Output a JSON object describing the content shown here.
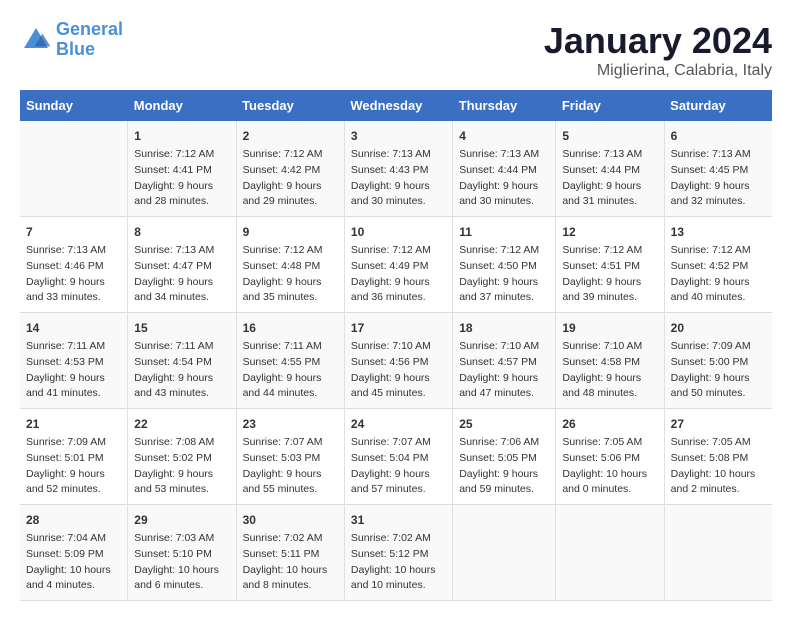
{
  "header": {
    "logo_line1": "General",
    "logo_line2": "Blue",
    "title": "January 2024",
    "subtitle": "Miglierina, Calabria, Italy"
  },
  "days_of_week": [
    "Sunday",
    "Monday",
    "Tuesday",
    "Wednesday",
    "Thursday",
    "Friday",
    "Saturday"
  ],
  "weeks": [
    [
      {
        "day": "",
        "content": ""
      },
      {
        "day": "1",
        "content": "Sunrise: 7:12 AM\nSunset: 4:41 PM\nDaylight: 9 hours\nand 28 minutes."
      },
      {
        "day": "2",
        "content": "Sunrise: 7:12 AM\nSunset: 4:42 PM\nDaylight: 9 hours\nand 29 minutes."
      },
      {
        "day": "3",
        "content": "Sunrise: 7:13 AM\nSunset: 4:43 PM\nDaylight: 9 hours\nand 30 minutes."
      },
      {
        "day": "4",
        "content": "Sunrise: 7:13 AM\nSunset: 4:44 PM\nDaylight: 9 hours\nand 30 minutes."
      },
      {
        "day": "5",
        "content": "Sunrise: 7:13 AM\nSunset: 4:44 PM\nDaylight: 9 hours\nand 31 minutes."
      },
      {
        "day": "6",
        "content": "Sunrise: 7:13 AM\nSunset: 4:45 PM\nDaylight: 9 hours\nand 32 minutes."
      }
    ],
    [
      {
        "day": "7",
        "content": "Sunrise: 7:13 AM\nSunset: 4:46 PM\nDaylight: 9 hours\nand 33 minutes."
      },
      {
        "day": "8",
        "content": "Sunrise: 7:13 AM\nSunset: 4:47 PM\nDaylight: 9 hours\nand 34 minutes."
      },
      {
        "day": "9",
        "content": "Sunrise: 7:12 AM\nSunset: 4:48 PM\nDaylight: 9 hours\nand 35 minutes."
      },
      {
        "day": "10",
        "content": "Sunrise: 7:12 AM\nSunset: 4:49 PM\nDaylight: 9 hours\nand 36 minutes."
      },
      {
        "day": "11",
        "content": "Sunrise: 7:12 AM\nSunset: 4:50 PM\nDaylight: 9 hours\nand 37 minutes."
      },
      {
        "day": "12",
        "content": "Sunrise: 7:12 AM\nSunset: 4:51 PM\nDaylight: 9 hours\nand 39 minutes."
      },
      {
        "day": "13",
        "content": "Sunrise: 7:12 AM\nSunset: 4:52 PM\nDaylight: 9 hours\nand 40 minutes."
      }
    ],
    [
      {
        "day": "14",
        "content": "Sunrise: 7:11 AM\nSunset: 4:53 PM\nDaylight: 9 hours\nand 41 minutes."
      },
      {
        "day": "15",
        "content": "Sunrise: 7:11 AM\nSunset: 4:54 PM\nDaylight: 9 hours\nand 43 minutes."
      },
      {
        "day": "16",
        "content": "Sunrise: 7:11 AM\nSunset: 4:55 PM\nDaylight: 9 hours\nand 44 minutes."
      },
      {
        "day": "17",
        "content": "Sunrise: 7:10 AM\nSunset: 4:56 PM\nDaylight: 9 hours\nand 45 minutes."
      },
      {
        "day": "18",
        "content": "Sunrise: 7:10 AM\nSunset: 4:57 PM\nDaylight: 9 hours\nand 47 minutes."
      },
      {
        "day": "19",
        "content": "Sunrise: 7:10 AM\nSunset: 4:58 PM\nDaylight: 9 hours\nand 48 minutes."
      },
      {
        "day": "20",
        "content": "Sunrise: 7:09 AM\nSunset: 5:00 PM\nDaylight: 9 hours\nand 50 minutes."
      }
    ],
    [
      {
        "day": "21",
        "content": "Sunrise: 7:09 AM\nSunset: 5:01 PM\nDaylight: 9 hours\nand 52 minutes."
      },
      {
        "day": "22",
        "content": "Sunrise: 7:08 AM\nSunset: 5:02 PM\nDaylight: 9 hours\nand 53 minutes."
      },
      {
        "day": "23",
        "content": "Sunrise: 7:07 AM\nSunset: 5:03 PM\nDaylight: 9 hours\nand 55 minutes."
      },
      {
        "day": "24",
        "content": "Sunrise: 7:07 AM\nSunset: 5:04 PM\nDaylight: 9 hours\nand 57 minutes."
      },
      {
        "day": "25",
        "content": "Sunrise: 7:06 AM\nSunset: 5:05 PM\nDaylight: 9 hours\nand 59 minutes."
      },
      {
        "day": "26",
        "content": "Sunrise: 7:05 AM\nSunset: 5:06 PM\nDaylight: 10 hours\nand 0 minutes."
      },
      {
        "day": "27",
        "content": "Sunrise: 7:05 AM\nSunset: 5:08 PM\nDaylight: 10 hours\nand 2 minutes."
      }
    ],
    [
      {
        "day": "28",
        "content": "Sunrise: 7:04 AM\nSunset: 5:09 PM\nDaylight: 10 hours\nand 4 minutes."
      },
      {
        "day": "29",
        "content": "Sunrise: 7:03 AM\nSunset: 5:10 PM\nDaylight: 10 hours\nand 6 minutes."
      },
      {
        "day": "30",
        "content": "Sunrise: 7:02 AM\nSunset: 5:11 PM\nDaylight: 10 hours\nand 8 minutes."
      },
      {
        "day": "31",
        "content": "Sunrise: 7:02 AM\nSunset: 5:12 PM\nDaylight: 10 hours\nand 10 minutes."
      },
      {
        "day": "",
        "content": ""
      },
      {
        "day": "",
        "content": ""
      },
      {
        "day": "",
        "content": ""
      }
    ]
  ]
}
